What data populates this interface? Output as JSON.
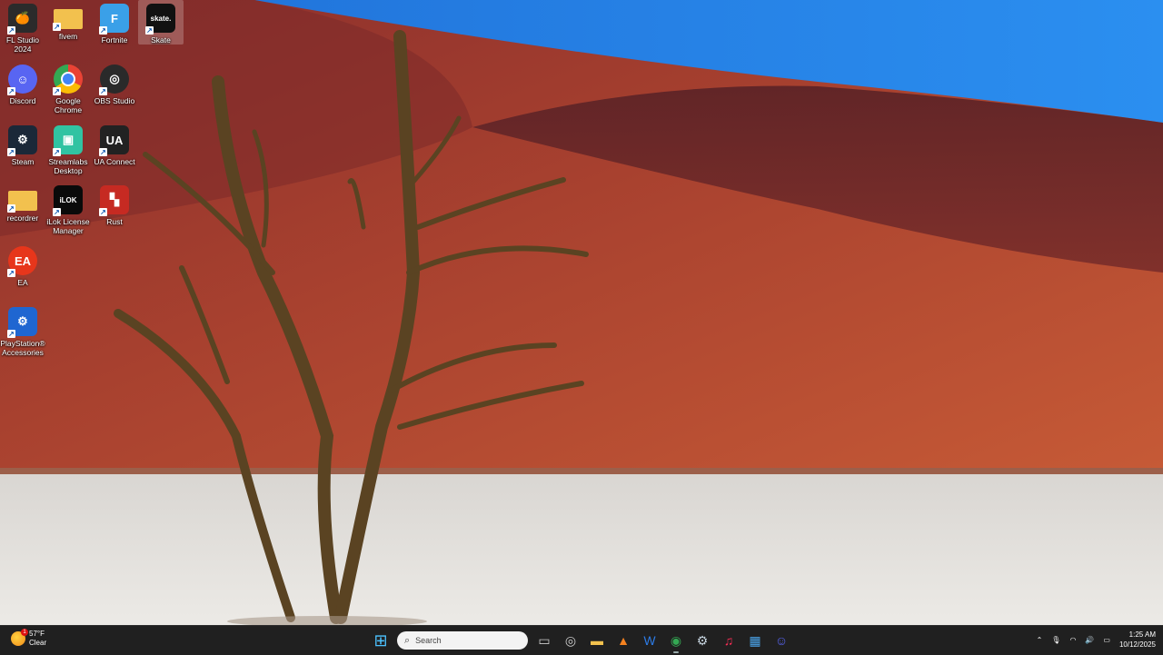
{
  "desktop": {
    "icons": [
      {
        "label": "FL Studio 2024",
        "name": "fl-studio-icon",
        "glyph": "🍊",
        "bg": "#2b2b2b"
      },
      {
        "label": "fivem",
        "name": "folder-icon",
        "glyph": "",
        "bg": "#f2c14e"
      },
      {
        "label": "Fortnite",
        "name": "fortnite-icon",
        "glyph": "F",
        "bg": "#3aa0e8"
      },
      {
        "label": "Skate",
        "name": "skate-icon",
        "glyph": "skate.",
        "bg": "#111111"
      },
      {
        "label": "Discord",
        "name": "discord-icon",
        "glyph": "☺",
        "bg": "#5865f2"
      },
      {
        "label": "Google Chrome",
        "name": "chrome-icon",
        "glyph": "",
        "bg": "#ffffff"
      },
      {
        "label": "OBS Studio",
        "name": "obs-icon",
        "glyph": "◎",
        "bg": "#2a2a2a"
      },
      {
        "label": "Steam",
        "name": "steam-icon",
        "glyph": "⚙",
        "bg": "#1b2838"
      },
      {
        "label": "Streamlabs Desktop",
        "name": "streamlabs-icon",
        "glyph": "▣",
        "bg": "#31c3a2"
      },
      {
        "label": "UA Connect",
        "name": "ua-connect-icon",
        "glyph": "UA",
        "bg": "#222222"
      },
      {
        "label": "recordrer",
        "name": "folder-icon",
        "glyph": "",
        "bg": "#f2c14e"
      },
      {
        "label": "iLok License Manager",
        "name": "ilok-icon",
        "glyph": "iLOK",
        "bg": "#0a0a0a"
      },
      {
        "label": "Rust",
        "name": "rust-icon",
        "glyph": "▚",
        "bg": "#c62a22"
      },
      {
        "label": "EA",
        "name": "ea-icon",
        "glyph": "EA",
        "bg": "#e7361b"
      },
      {
        "label": "PlayStation® Accessories",
        "name": "playstation-accessories-icon",
        "glyph": "⚙",
        "bg": "#1f66d1"
      }
    ]
  },
  "taskbar": {
    "weather_temp": "57°F",
    "weather_cond": "Clear",
    "weather_badge": "1",
    "search_placeholder": "Search",
    "pinned": [
      {
        "name": "start-button",
        "glyph": "⊞",
        "color": "#4cc2ff"
      },
      {
        "name": "task-view-icon",
        "glyph": "▭",
        "color": "#cccccc"
      },
      {
        "name": "obs-taskbar-icon",
        "glyph": "◎",
        "color": "#cccccc"
      },
      {
        "name": "file-explorer-icon",
        "glyph": "▬",
        "color": "#f2c14e"
      },
      {
        "name": "app-orange-icon",
        "glyph": "▲",
        "color": "#f5821f"
      },
      {
        "name": "app-blue-icon",
        "glyph": "W",
        "color": "#2d7be5"
      },
      {
        "name": "chrome-taskbar-icon",
        "glyph": "◉",
        "color": "#34a853"
      },
      {
        "name": "steam-taskbar-icon",
        "glyph": "⚙",
        "color": "#c7d5e0"
      },
      {
        "name": "apple-music-icon",
        "glyph": "♫",
        "color": "#fa2d55"
      },
      {
        "name": "photos-icon",
        "glyph": "▦",
        "color": "#4aa3e8"
      },
      {
        "name": "discord-taskbar-icon",
        "glyph": "☺",
        "color": "#5865f2"
      }
    ],
    "time": "1:25 AM",
    "date": "10/12/2025"
  }
}
